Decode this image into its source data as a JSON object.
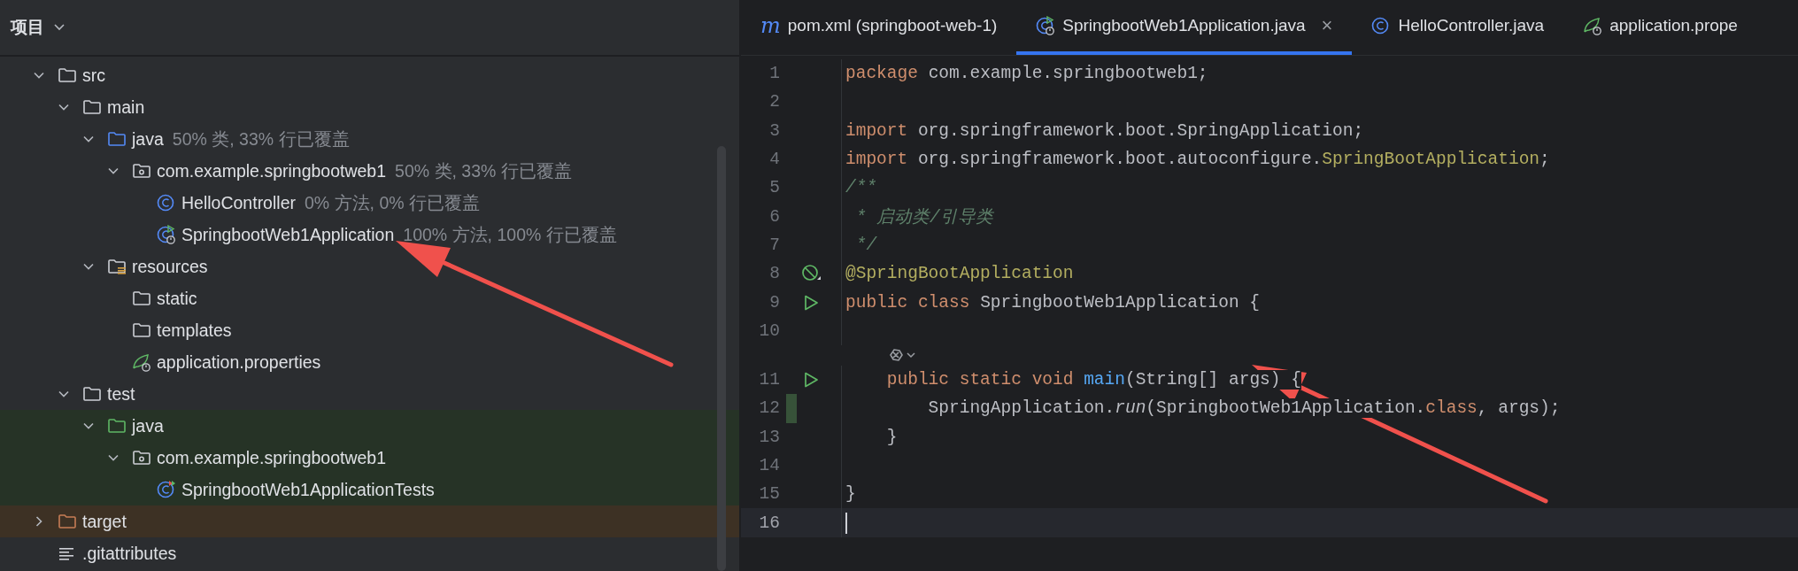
{
  "project_panel": {
    "title": "项目",
    "tree": [
      {
        "name": "src",
        "kind": "folder",
        "expanded": true,
        "children": [
          {
            "name": "main",
            "kind": "folder",
            "expanded": true,
            "children": [
              {
                "name": "java",
                "kind": "source-folder",
                "coverage": "50% 类, 33% 行已覆盖",
                "expanded": true,
                "children": [
                  {
                    "name": "com.example.springbootweb1",
                    "kind": "package",
                    "coverage": "50% 类, 33% 行已覆盖",
                    "expanded": true,
                    "children": [
                      {
                        "name": "HelloController",
                        "kind": "class",
                        "coverage": "0% 方法, 0% 行已覆盖"
                      },
                      {
                        "name": "SpringbootWeb1Application",
                        "kind": "spring-app",
                        "coverage": "100% 方法, 100% 行已覆盖"
                      }
                    ]
                  }
                ]
              },
              {
                "name": "resources",
                "kind": "resources-folder",
                "expanded": true,
                "children": [
                  {
                    "name": "static",
                    "kind": "folder"
                  },
                  {
                    "name": "templates",
                    "kind": "folder"
                  },
                  {
                    "name": "application.properties",
                    "kind": "properties"
                  }
                ]
              }
            ]
          },
          {
            "name": "test",
            "kind": "folder",
            "expanded": true,
            "children": [
              {
                "name": "java",
                "kind": "test-folder",
                "color": "#263326",
                "expanded": true,
                "children": [
                  {
                    "name": "com.example.springbootweb1",
                    "kind": "package",
                    "color": "#263326",
                    "expanded": true,
                    "children": [
                      {
                        "name": "SpringbootWeb1ApplicationTests",
                        "kind": "test-class",
                        "color": "#263326"
                      }
                    ]
                  }
                ]
              }
            ]
          }
        ]
      },
      {
        "name": "target",
        "kind": "excluded-folder",
        "color": "#3d3124",
        "expanded": false
      },
      {
        "name": ".gitattributes",
        "kind": "text-file"
      }
    ]
  },
  "editor": {
    "tabs": [
      {
        "label": "pom.xml (springboot-web-1)",
        "kind": "maven",
        "glyph": "m",
        "selected": false
      },
      {
        "label": "SpringbootWeb1Application.java",
        "kind": "spring-app",
        "close": "×",
        "selected": true
      },
      {
        "label": "HelloController.java",
        "kind": "class",
        "selected": false
      },
      {
        "label": "application.prope",
        "kind": "properties",
        "selected": false
      }
    ],
    "lines": [
      {
        "kind": "code",
        "number": "1",
        "changed": false,
        "current": false,
        "tokens": [
          {
            "t": "package ",
            "kind": "kw"
          },
          {
            "t": "com.example.springbootweb1;",
            "kind": "plain"
          }
        ]
      },
      {
        "kind": "code",
        "number": "2",
        "changed": false,
        "current": false
      },
      {
        "kind": "code",
        "number": "3",
        "changed": false,
        "current": false,
        "tokens": [
          {
            "t": "import ",
            "kind": "kw"
          },
          {
            "t": "org.springframework.boot.SpringApplication;",
            "kind": "plain"
          }
        ]
      },
      {
        "kind": "code",
        "number": "4",
        "changed": false,
        "current": false,
        "tokens": [
          {
            "t": "import ",
            "kind": "kw"
          },
          {
            "t": "org.springframework.boot.autoconfigure.",
            "kind": "plain"
          },
          {
            "t": "SpringBootApplication",
            "kind": "ann"
          },
          {
            "t": ";",
            "kind": "plain"
          }
        ]
      },
      {
        "kind": "code",
        "number": "5",
        "changed": false,
        "current": false,
        "tokens": [
          {
            "t": "/**",
            "kind": "comment"
          }
        ]
      },
      {
        "kind": "code",
        "number": "6",
        "changed": false,
        "current": false,
        "tokens": [
          {
            "t": " * 启动类/引导类",
            "kind": "comment"
          }
        ]
      },
      {
        "kind": "code",
        "number": "7",
        "changed": false,
        "current": false,
        "tokens": [
          {
            "t": " */",
            "kind": "comment"
          }
        ]
      },
      {
        "kind": "code",
        "number": "8",
        "gutter": {
          "kind": "bean"
        },
        "changed": false,
        "current": false,
        "tokens": [
          {
            "t": "@SpringBootApplication",
            "kind": "ann"
          }
        ]
      },
      {
        "kind": "code",
        "number": "9",
        "gutter": {
          "kind": "run"
        },
        "changed": false,
        "current": false,
        "tokens": [
          {
            "t": "public class ",
            "kind": "kw"
          },
          {
            "t": "SpringbootWeb1Application {",
            "kind": "plain"
          }
        ]
      },
      {
        "kind": "code",
        "number": "10",
        "changed": false,
        "current": false
      },
      {
        "kind": "inlay"
      },
      {
        "kind": "code",
        "number": "11",
        "gutter": {
          "kind": "run"
        },
        "changed": false,
        "current": false,
        "tokens": [
          {
            "t": "    public static void ",
            "kind": "kw"
          },
          {
            "t": "main",
            "kind": "method"
          },
          {
            "t": "(String[] args) {",
            "kind": "plain"
          }
        ]
      },
      {
        "kind": "code",
        "number": "12",
        "changed": true,
        "current": false,
        "tokens": [
          {
            "t": "        SpringApplication.",
            "kind": "plain"
          },
          {
            "t": "run",
            "kind": "static"
          },
          {
            "t": "(SpringbootWeb1Application.",
            "kind": "plain"
          },
          {
            "t": "class",
            "kind": "kw"
          },
          {
            "t": ", args);",
            "kind": "plain"
          }
        ]
      },
      {
        "kind": "code",
        "number": "13",
        "changed": false,
        "current": false,
        "tokens": [
          {
            "t": "    }",
            "kind": "plain"
          }
        ]
      },
      {
        "kind": "code",
        "number": "14",
        "changed": false,
        "current": false
      },
      {
        "kind": "code",
        "number": "15",
        "changed": false,
        "current": false,
        "tokens": [
          {
            "t": "}",
            "kind": "plain"
          }
        ]
      },
      {
        "kind": "code",
        "number": "16",
        "changed": false,
        "current": true
      }
    ]
  }
}
